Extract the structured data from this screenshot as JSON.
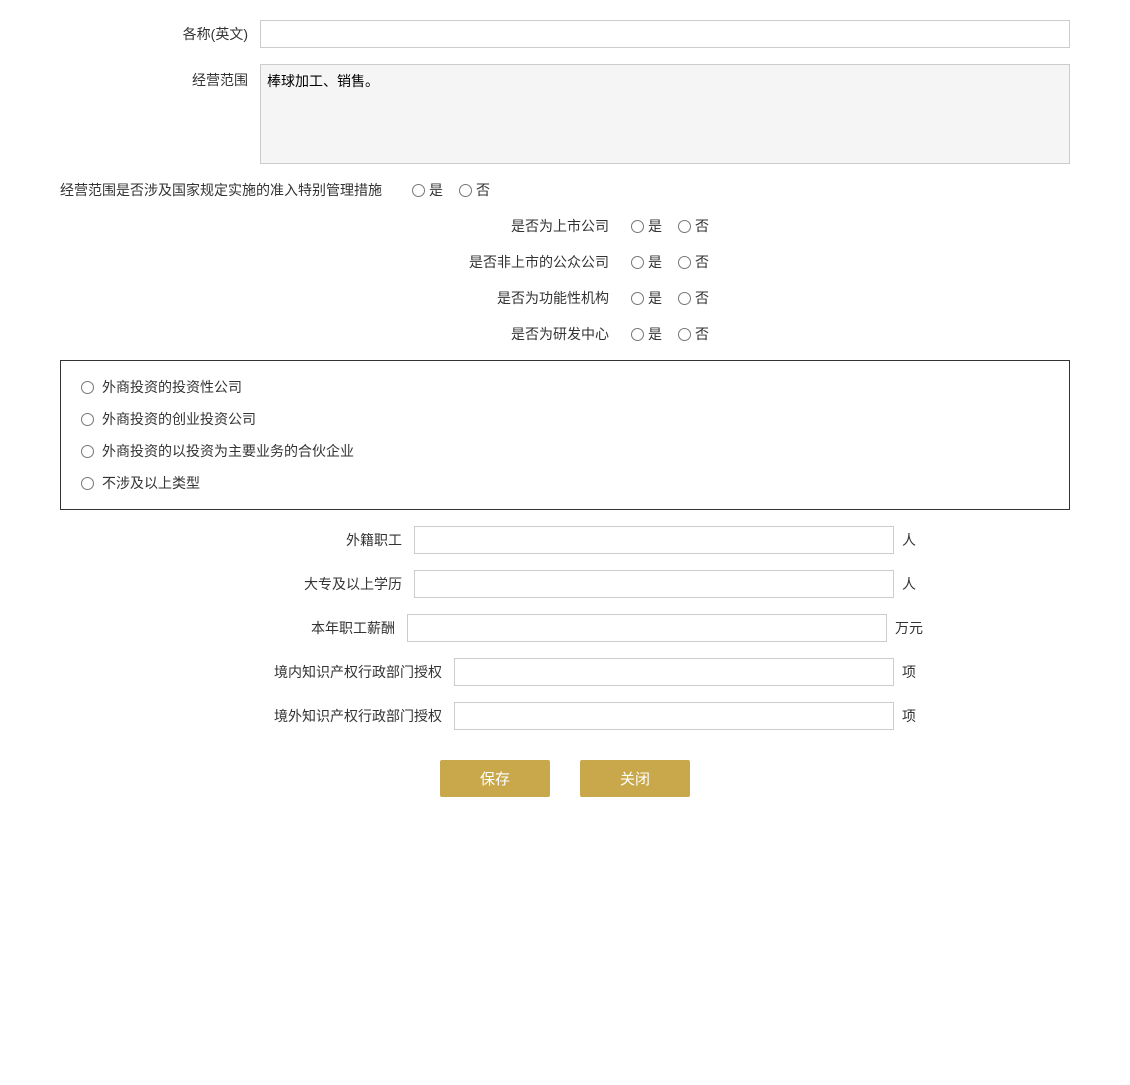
{
  "form": {
    "name_en_label": "各称(英文)",
    "name_en_value": "",
    "name_en_placeholder": "",
    "business_scope_label": "经营范围",
    "business_scope_value": "棒球加工、销售。",
    "special_mgmt_label": "经营范围是否涉及国家规定实施的准入特别管理措施",
    "special_mgmt_yes": "是",
    "special_mgmt_no": "否",
    "listed_company_label": "是否为上市公司",
    "listed_yes": "是",
    "listed_no": "否",
    "non_listed_public_label": "是否非上市的公众公司",
    "non_listed_yes": "是",
    "non_listed_no": "否",
    "functional_org_label": "是否为功能性机构",
    "functional_yes": "是",
    "functional_no": "否",
    "rd_center_label": "是否为研发中心",
    "rd_yes": "是",
    "rd_no": "否",
    "invest_company_option": "外商投资的投资性公司",
    "venture_invest_option": "外商投资的创业投资公司",
    "partner_invest_option": "外商投资的以投资为主要业务的合伙企业",
    "not_applicable_option": "不涉及以上类型",
    "foreign_staff_label": "外籍职工",
    "foreign_staff_unit": "人",
    "foreign_staff_value": "",
    "college_edu_label": "大专及以上学历",
    "college_edu_unit": "人",
    "college_edu_value": "",
    "annual_salary_label": "本年职工薪酬",
    "annual_salary_unit": "万元",
    "annual_salary_value": "",
    "domestic_ip_label": "境内知识产权行政部门授权",
    "domestic_ip_unit": "项",
    "domestic_ip_value": "",
    "foreign_ip_label": "境外知识产权行政部门授权",
    "foreign_ip_unit": "项",
    "foreign_ip_value": "",
    "save_btn": "保存",
    "close_btn": "关闭"
  }
}
